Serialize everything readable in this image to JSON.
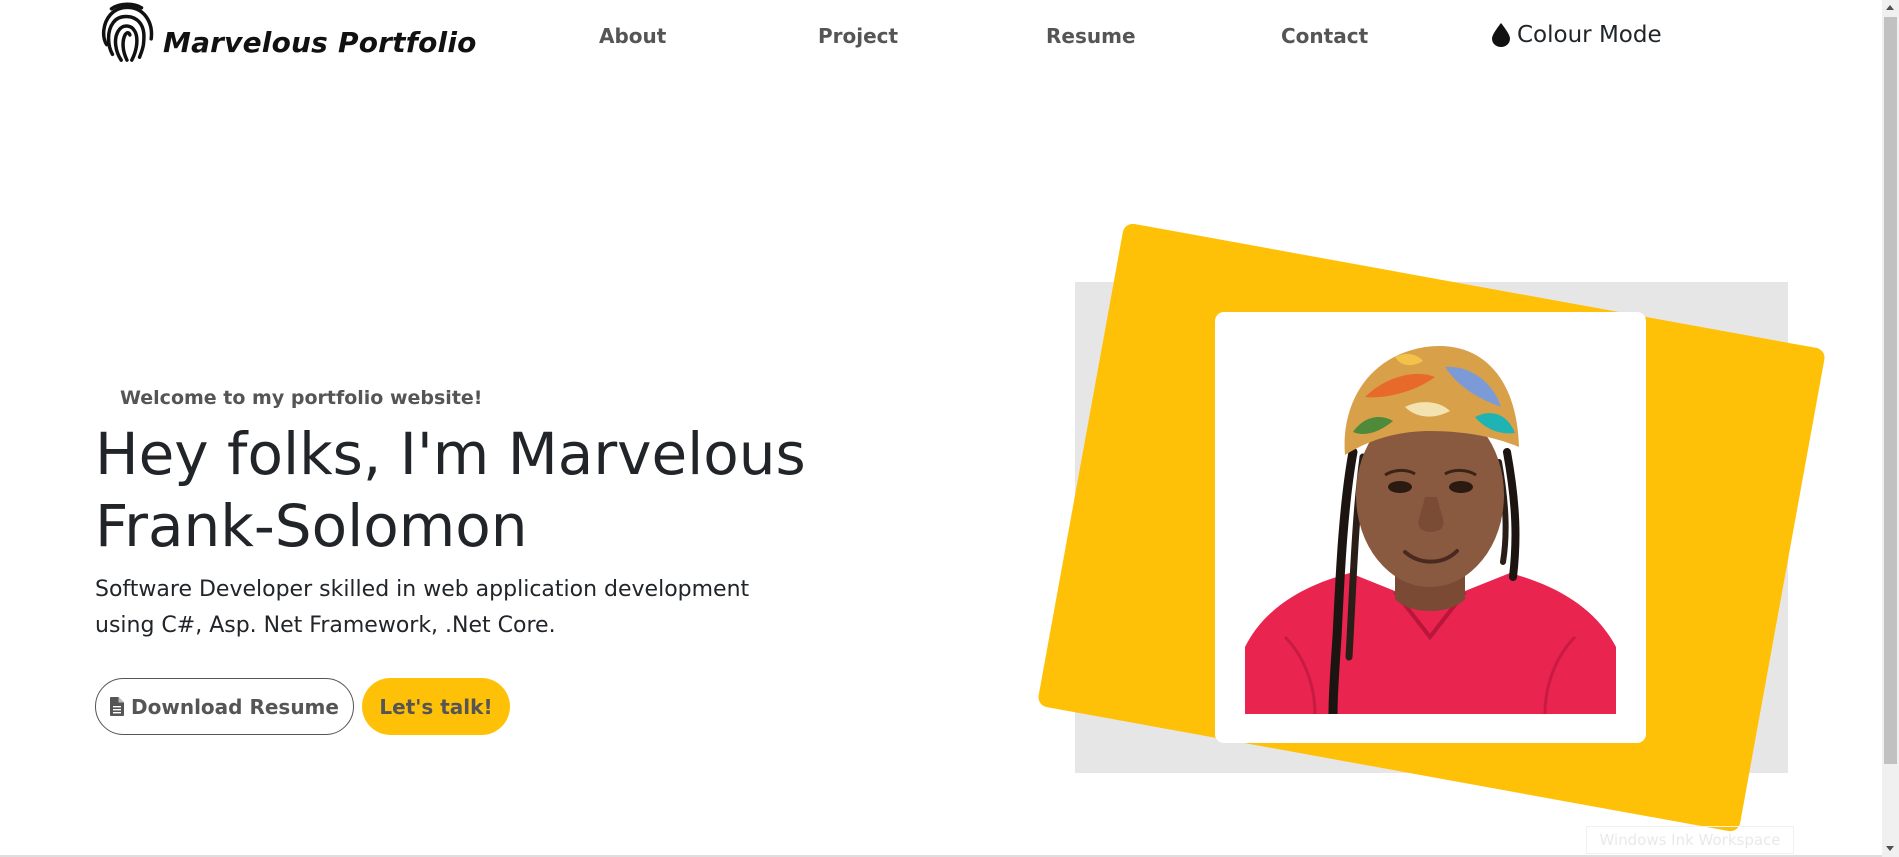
{
  "navbar": {
    "brand_name": "Marvelous Portfolio",
    "brand_icon": "fingerprint-icon",
    "links": [
      {
        "label": "About"
      },
      {
        "label": "Project"
      },
      {
        "label": "Resume"
      },
      {
        "label": "Contact"
      }
    ],
    "colour_mode": {
      "label": "Colour Mode",
      "icon": "droplet-icon"
    }
  },
  "hero": {
    "welcome": "Welcome to my portfolio website!",
    "title": "Hey folks, I'm Marvelous Frank-Solomon",
    "description": "Software Developer skilled in web application development using C#, Asp. Net Framework, .Net Core.",
    "download_button": {
      "label": "Download Resume",
      "icon": "file-icon"
    },
    "talk_button": {
      "label": "Let's talk!"
    }
  },
  "watermark": "Windows Ink Workspace",
  "colors": {
    "accent": "#ffc107",
    "text_dark": "#212529",
    "text_muted": "#555555",
    "panel_grey": "#e7e6e7",
    "background": "#ffffff"
  }
}
